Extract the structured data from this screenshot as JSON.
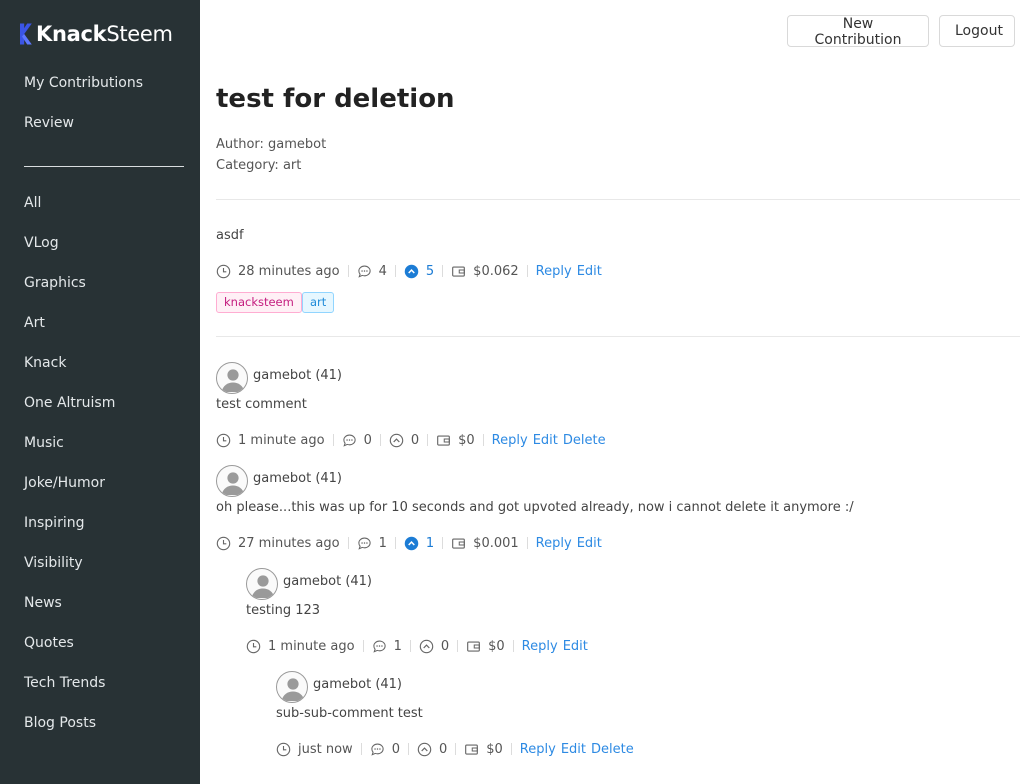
{
  "brand": {
    "part1": "Knack",
    "part2": "Steem"
  },
  "sidebar": {
    "top_items": [
      {
        "label": "My Contributions"
      },
      {
        "label": "Review"
      }
    ],
    "categories": [
      {
        "label": "All"
      },
      {
        "label": "VLog"
      },
      {
        "label": "Graphics"
      },
      {
        "label": "Art"
      },
      {
        "label": "Knack"
      },
      {
        "label": "One Altruism"
      },
      {
        "label": "Music"
      },
      {
        "label": "Joke/Humor"
      },
      {
        "label": "Inspiring"
      },
      {
        "label": "Visibility"
      },
      {
        "label": "News"
      },
      {
        "label": "Quotes"
      },
      {
        "label": "Tech Trends"
      },
      {
        "label": "Blog Posts"
      }
    ]
  },
  "header": {
    "new_contribution": "New Contribution",
    "logout": "Logout"
  },
  "post": {
    "title": "test for deletion",
    "author_line": "Author: gamebot",
    "category_line": "Category: art",
    "body": "asdf",
    "time": "28 minutes ago",
    "comments": "4",
    "upvotes": "5",
    "payout": "$0.062",
    "reply": "Reply",
    "edit": "Edit",
    "tags": [
      "knacksteem",
      "art"
    ]
  },
  "comments": [
    {
      "author": "gamebot (41)",
      "text": "test comment",
      "time": "1 minute ago",
      "comments": "0",
      "upvotes": "0",
      "payout": "$0",
      "reply": "Reply",
      "edit": "Edit",
      "delete": "Delete"
    },
    {
      "author": "gamebot (41)",
      "text": "oh please...this was up for 10 seconds and got upvoted already, now i cannot delete it anymore :/",
      "time": "27 minutes ago",
      "comments": "1",
      "upvotes": "1",
      "payout": "$0.001",
      "reply": "Reply",
      "edit": "Edit"
    },
    {
      "author": "gamebot (41)",
      "text": "testing 123",
      "time": "1 minute ago",
      "comments": "1",
      "upvotes": "0",
      "payout": "$0",
      "reply": "Reply",
      "edit": "Edit"
    },
    {
      "author": "gamebot (41)",
      "text": "sub-sub-comment test",
      "time": "just now",
      "comments": "0",
      "upvotes": "0",
      "payout": "$0",
      "reply": "Reply",
      "edit": "Edit",
      "delete": "Delete"
    }
  ],
  "colors": {
    "sidebar_bg": "#283235",
    "link": "#2d8ae3",
    "brand_mark": "#3b55e6"
  }
}
